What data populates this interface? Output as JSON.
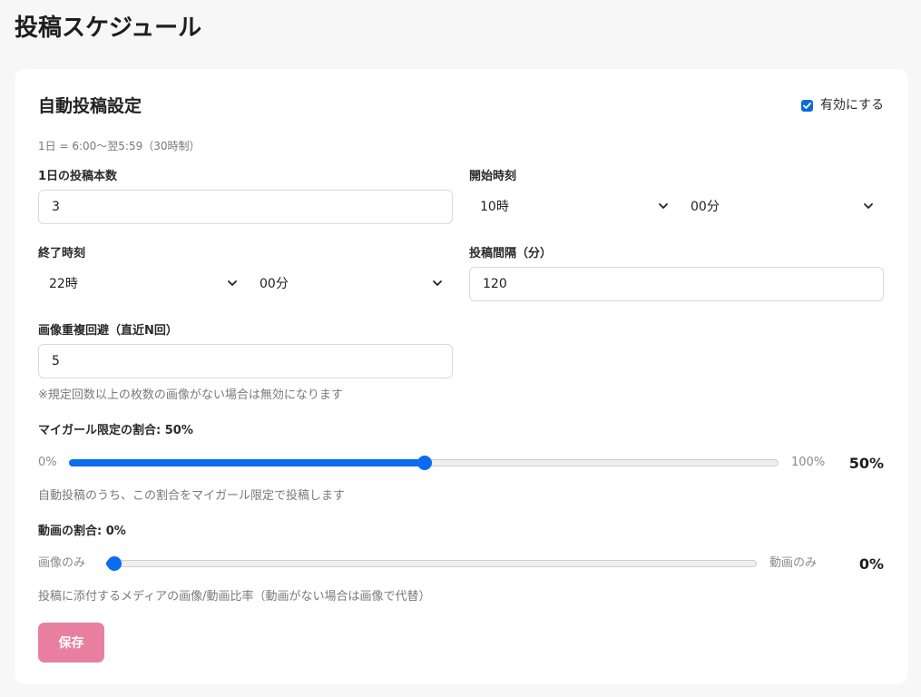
{
  "page": {
    "title": "投稿スケジュール"
  },
  "auto_post": {
    "title": "自動投稿設定",
    "enable_label": "有効にする",
    "enabled": true,
    "day_note": "1日 = 6:00〜翌5:59（30時制）",
    "posts_per_day": {
      "label": "1日の投稿本数",
      "value": "3"
    },
    "start_time": {
      "label": "開始時刻",
      "hour": "10時",
      "minute": "00分"
    },
    "end_time": {
      "label": "終了時刻",
      "hour": "22時",
      "minute": "00分"
    },
    "interval": {
      "label": "投稿間隔（分）",
      "value": "120"
    },
    "image_dedup": {
      "label": "画像重複回避（直近N回）",
      "value": "5",
      "help": "※規定回数以上の枚数の画像がない場合は無効になります"
    },
    "my_girl_ratio": {
      "label": "マイガール限定の割合: 50%",
      "min_label": "0%",
      "max_label": "100%",
      "value_label": "50%",
      "value": 50,
      "help": "自動投稿のうち、この割合をマイガール限定で投稿します"
    },
    "video_ratio": {
      "label": "動画の割合: 0%",
      "min_label": "画像のみ",
      "max_label": "動画のみ",
      "value_label": "0%",
      "value": 0,
      "help": "投稿に添付するメディアの画像/動画比率（動画がない場合は画像で代替）"
    },
    "save_label": "保存"
  },
  "colors": {
    "accent": "#0a6cf0",
    "save_button": "#e97fa0",
    "background": "#f8f7f7"
  }
}
